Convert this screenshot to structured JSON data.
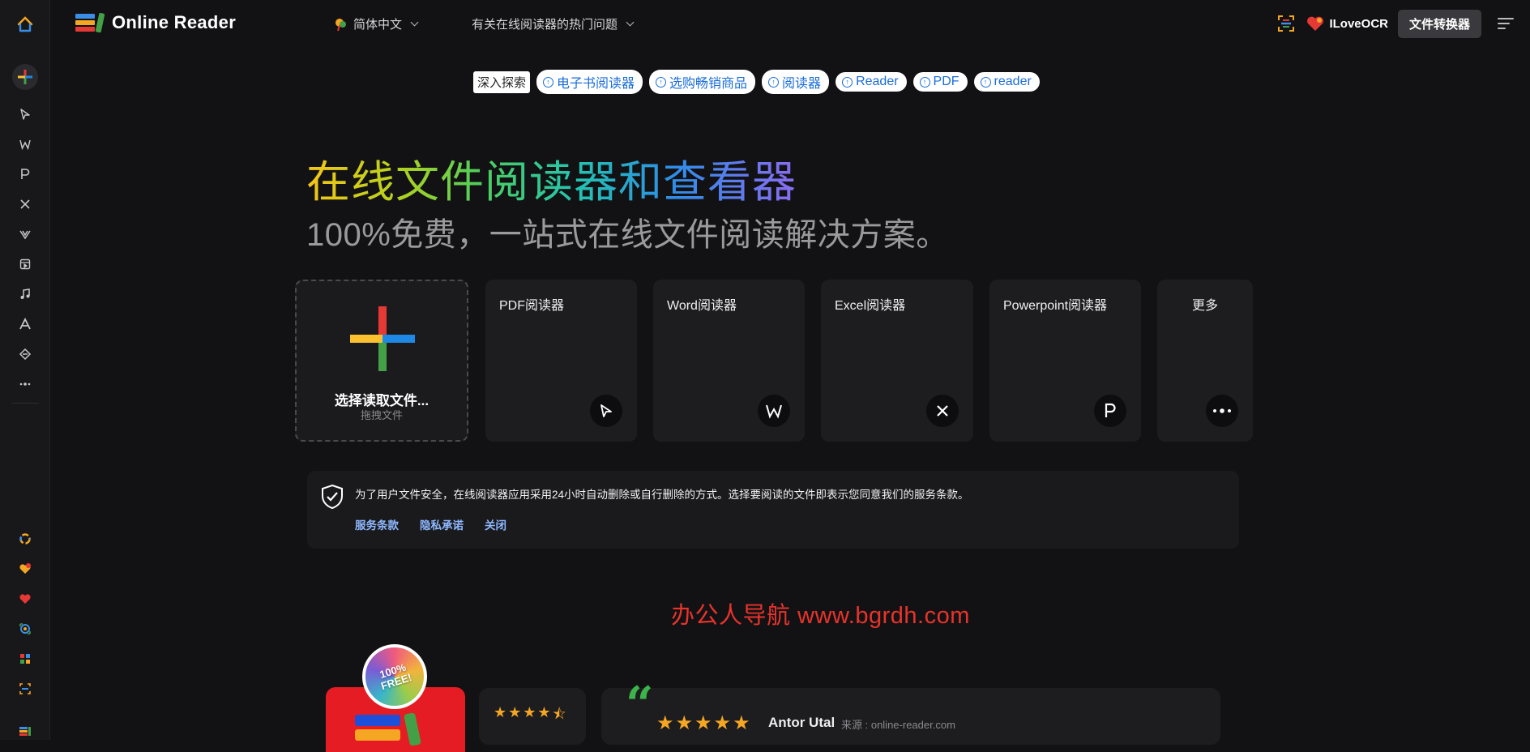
{
  "header": {
    "app_title": "Online Reader",
    "language": "简体中文",
    "faq": "有关在线阅读器的热门问题",
    "iloveocr": "ILoveOCR",
    "converter_button": "文件转换器"
  },
  "sidebar": {
    "icons": [
      "home-icon",
      "add-file-icon",
      "pdf-icon",
      "word-icon",
      "powerpoint-icon",
      "excel-icon",
      "vector-icon",
      "media-icon",
      "music-icon",
      "font-icon",
      "ebook-icon",
      "more-icon",
      "app-1-icon",
      "app-2-icon",
      "app-3-icon",
      "app-4-icon",
      "app-5-icon",
      "app-6-icon",
      "app-7-icon"
    ]
  },
  "explore": {
    "label": "深入探索",
    "chips": [
      "电子书阅读器",
      "选购畅销商品",
      "阅读器",
      "Reader",
      "PDF",
      "reader"
    ]
  },
  "hero": {
    "title": "在线文件阅读器和查看器",
    "subtitle": "100%免费，一站式在线文件阅读解决方案。"
  },
  "upload": {
    "label": "选择读取文件...",
    "sub": "拖拽文件"
  },
  "cards": [
    {
      "title": "PDF阅读器",
      "badge": "pdf-icon"
    },
    {
      "title": "Word阅读器",
      "badge": "W"
    },
    {
      "title": "Excel阅读器",
      "badge": "X"
    },
    {
      "title": "Powerpoint阅读器",
      "badge": "P"
    },
    {
      "title": "更多",
      "badge": "more-icon"
    }
  ],
  "notice": {
    "text": "为了用户文件安全，在线阅读器应用采用24小时自动删除或自行删除的方式。选择要阅读的文件即表示您同意我们的服务条款。",
    "links": [
      "服务条款",
      "隐私承诺",
      "关闭"
    ]
  },
  "watermark": "办公人导航  www.bgrdh.com",
  "promo": {
    "badge": "100% FREE!"
  },
  "review": {
    "name": "Antor Utal",
    "source": "来源 : online-reader.com",
    "rating_small": 4.5,
    "rating": 5
  },
  "colors": {
    "background": "#121214",
    "card": "#1d1d20",
    "chip_text": "#1a6dd8",
    "link": "#8fb8ff",
    "watermark": "#e8332b"
  }
}
